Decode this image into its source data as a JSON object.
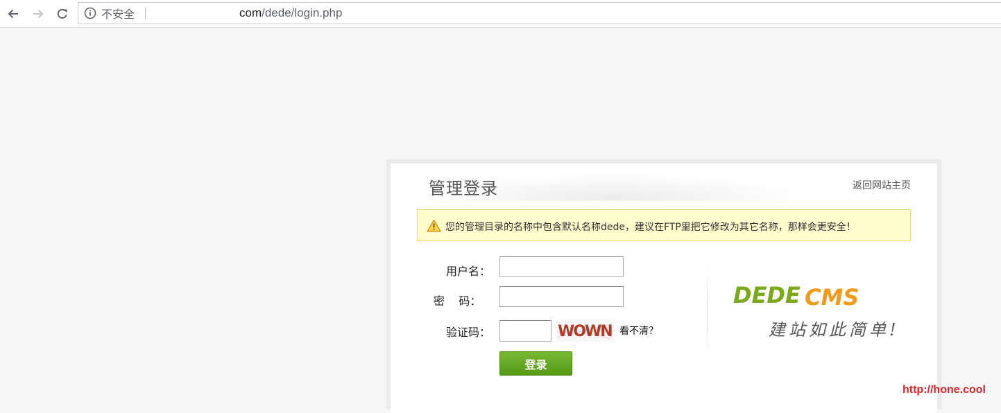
{
  "browser": {
    "security_label": "不安全",
    "url_domain": "com",
    "url_path": "/dede/login.php"
  },
  "panel": {
    "title": "管理登录",
    "back_link": "返回网站主页",
    "warning": "您的管理目录的名称中包含默认名称dede，建议在FTP里把它修改为其它名称，那样会更安全！"
  },
  "form": {
    "username_label": "用户名：",
    "username_value": "",
    "password_label": "密    码：",
    "password_value": "",
    "captcha_label": "验证码：",
    "captcha_value": "",
    "captcha_text": "WOWN",
    "captcha_refresh": "看不清？",
    "submit_label": "登录"
  },
  "branding": {
    "logo_text": "DEDECMS",
    "logo_part1": "DEDE",
    "logo_part2": "CMS",
    "slogan": "建站如此简单!",
    "colors": {
      "dede": "#7aaa1a",
      "cms": "#f39a1c"
    }
  },
  "watermark": "http://hone.cool",
  "colors": {
    "warning_bg": "#fffccd",
    "warning_border": "#f0d77f",
    "button_green": "#5fa220",
    "watermark_red": "#d9262d"
  },
  "icons": [
    "back-arrow-icon",
    "forward-arrow-icon",
    "reload-icon",
    "info-icon",
    "warning-triangle-icon"
  ]
}
